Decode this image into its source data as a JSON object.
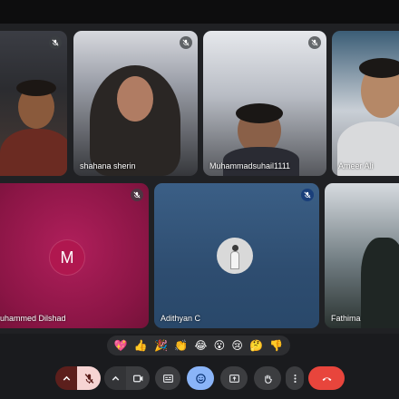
{
  "participants": [
    {
      "name": "",
      "muted": true
    },
    {
      "name": "shahana sherin",
      "muted": true
    },
    {
      "name": "Muhammadsuhail1111",
      "muted": true
    },
    {
      "name": "Ameer Ali",
      "muted": false
    },
    {
      "name": "uhammed Dilshad",
      "muted": true,
      "avatar_letter": "M"
    },
    {
      "name": "Adithyan C",
      "muted": true
    },
    {
      "name": "Fathima",
      "muted": false
    }
  ],
  "reactions": [
    "💖",
    "👍",
    "🎉",
    "👏",
    "😂",
    "😮",
    "😢",
    "🤔",
    "👎"
  ],
  "controls": {
    "mic_state": "muted",
    "buttons": [
      "more-audio-options",
      "microphone",
      "more-video-options",
      "camera",
      "captions",
      "reactions",
      "present",
      "raise-hand",
      "more-options",
      "leave-call"
    ]
  },
  "colors": {
    "leave": "#e8453c",
    "active": "#8ab4f8",
    "mic_muted_bg": "#f6d4d3",
    "avatar_m": "#b0174f"
  }
}
